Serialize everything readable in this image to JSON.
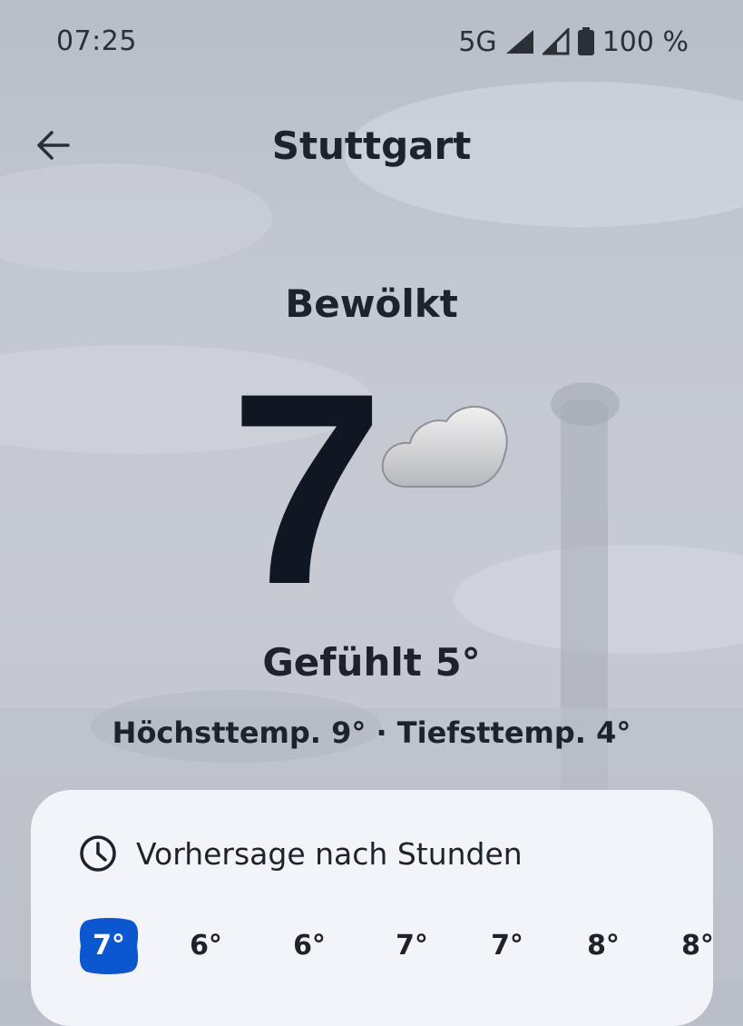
{
  "status": {
    "time": "07:25",
    "network": "5G",
    "battery": "100 %"
  },
  "header": {
    "city": "Stuttgart"
  },
  "current": {
    "condition": "Bewölkt",
    "temperature": "7",
    "feels_like": "Gefühlt 5°",
    "high_low": "Höchsttemp. 9° · Tiefsttemp. 4°",
    "icon": "cloud-icon"
  },
  "hourly": {
    "title": "Vorhersage nach Stunden",
    "temps": [
      "7°",
      "6°",
      "6°",
      "7°",
      "7°",
      "8°",
      "8°"
    ]
  },
  "colors": {
    "accent": "#0b57d0",
    "card": "#f3f4f9",
    "text": "#1d222b"
  }
}
